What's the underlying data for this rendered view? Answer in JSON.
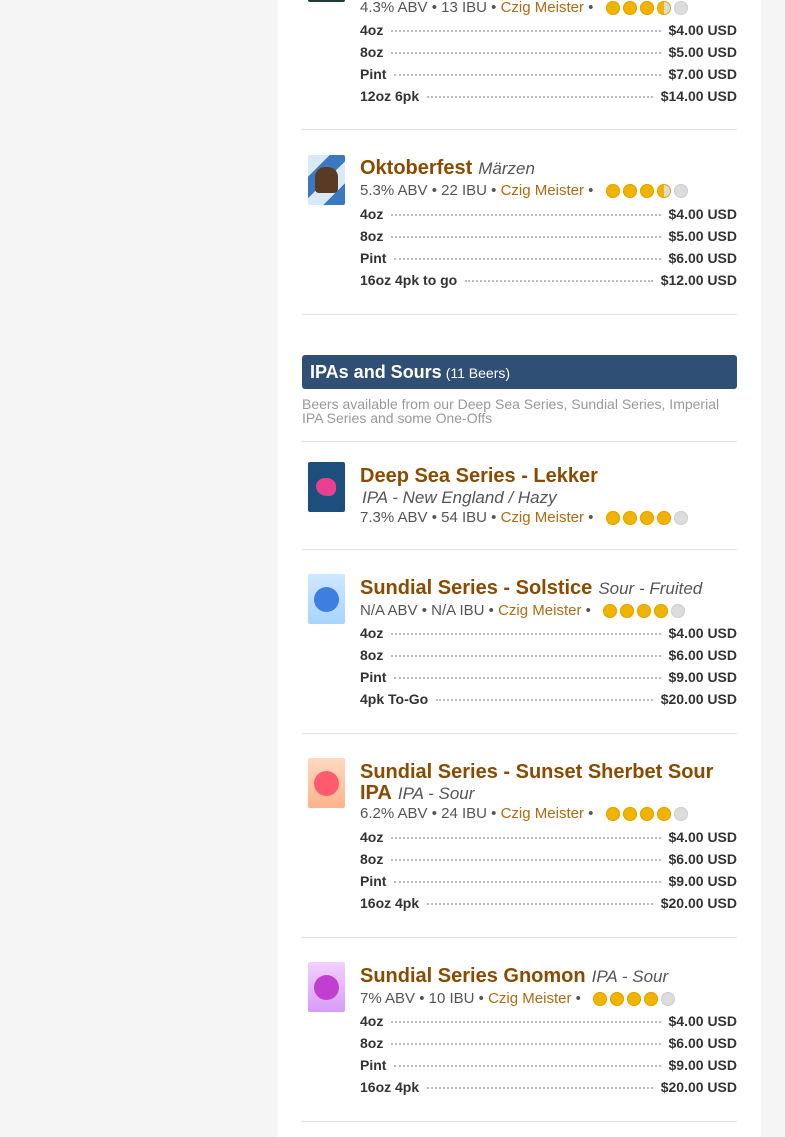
{
  "colors": {
    "brand_name": "#8a4b00",
    "brewery_link": "#b06a12",
    "section_bg": "#2f4f75",
    "star": "#f0b400"
  },
  "beers_top": [
    {
      "name": "",
      "style": "",
      "abv": "4.3% ABV",
      "ibu": "13 IBU",
      "brewery": "Czig Meister",
      "rating": 3.5,
      "prices": [
        {
          "size": "4oz",
          "price": "$4.00 USD"
        },
        {
          "size": "8oz",
          "price": "$5.00 USD"
        },
        {
          "size": "Pint",
          "price": "$7.00 USD"
        },
        {
          "size": "12oz 6pk",
          "price": "$14.00 USD"
        }
      ]
    },
    {
      "name": "Oktoberfest",
      "style": "Märzen",
      "abv": "5.3% ABV",
      "ibu": "22 IBU",
      "brewery": "Czig Meister",
      "rating": 3.5,
      "prices": [
        {
          "size": "4oz",
          "price": "$4.00 USD"
        },
        {
          "size": "8oz",
          "price": "$5.00 USD"
        },
        {
          "size": "Pint",
          "price": "$6.00 USD"
        },
        {
          "size": "16oz 4pk to go",
          "price": "$12.00 USD"
        }
      ]
    }
  ],
  "section": {
    "title": "IPAs and Sours",
    "count": "(11 Beers)",
    "description": "Beers available from our Deep Sea Series, Sundial Series, Imperial IPA Series and some One-Offs"
  },
  "beers": [
    {
      "name": "Deep Sea Series - Lekker",
      "style": "IPA - New England / Hazy",
      "abv": "7.3% ABV",
      "ibu": "54 IBU",
      "brewery": "Czig Meister",
      "rating": 4,
      "prices": []
    },
    {
      "name": "Sundial Series - Solstice",
      "style": "Sour - Fruited",
      "abv": "N/A ABV",
      "ibu": "N/A IBU",
      "brewery": "Czig Meister",
      "rating": 4,
      "prices": [
        {
          "size": "4oz",
          "price": "$4.00 USD"
        },
        {
          "size": "8oz",
          "price": "$6.00 USD"
        },
        {
          "size": "Pint",
          "price": "$9.00 USD"
        },
        {
          "size": "4pk To-Go",
          "price": "$20.00 USD"
        }
      ]
    },
    {
      "name": "Sundial Series - Sunset Sherbet Sour IPA",
      "style": "IPA - Sour",
      "abv": "6.2% ABV",
      "ibu": "24 IBU",
      "brewery": "Czig Meister",
      "rating": 4,
      "prices": [
        {
          "size": "4oz",
          "price": "$4.00 USD"
        },
        {
          "size": "8oz",
          "price": "$6.00 USD"
        },
        {
          "size": "Pint",
          "price": "$9.00 USD"
        },
        {
          "size": "16oz 4pk",
          "price": "$20.00 USD"
        }
      ]
    },
    {
      "name": "Sundial Series Gnomon",
      "style": "IPA - Sour",
      "abv": "7% ABV",
      "ibu": "10 IBU",
      "brewery": "Czig Meister",
      "rating": 4,
      "prices": [
        {
          "size": "4oz",
          "price": "$4.00 USD"
        },
        {
          "size": "8oz",
          "price": "$6.00 USD"
        },
        {
          "size": "Pint",
          "price": "$9.00 USD"
        },
        {
          "size": "16oz 4pk",
          "price": "$20.00 USD"
        }
      ]
    }
  ]
}
